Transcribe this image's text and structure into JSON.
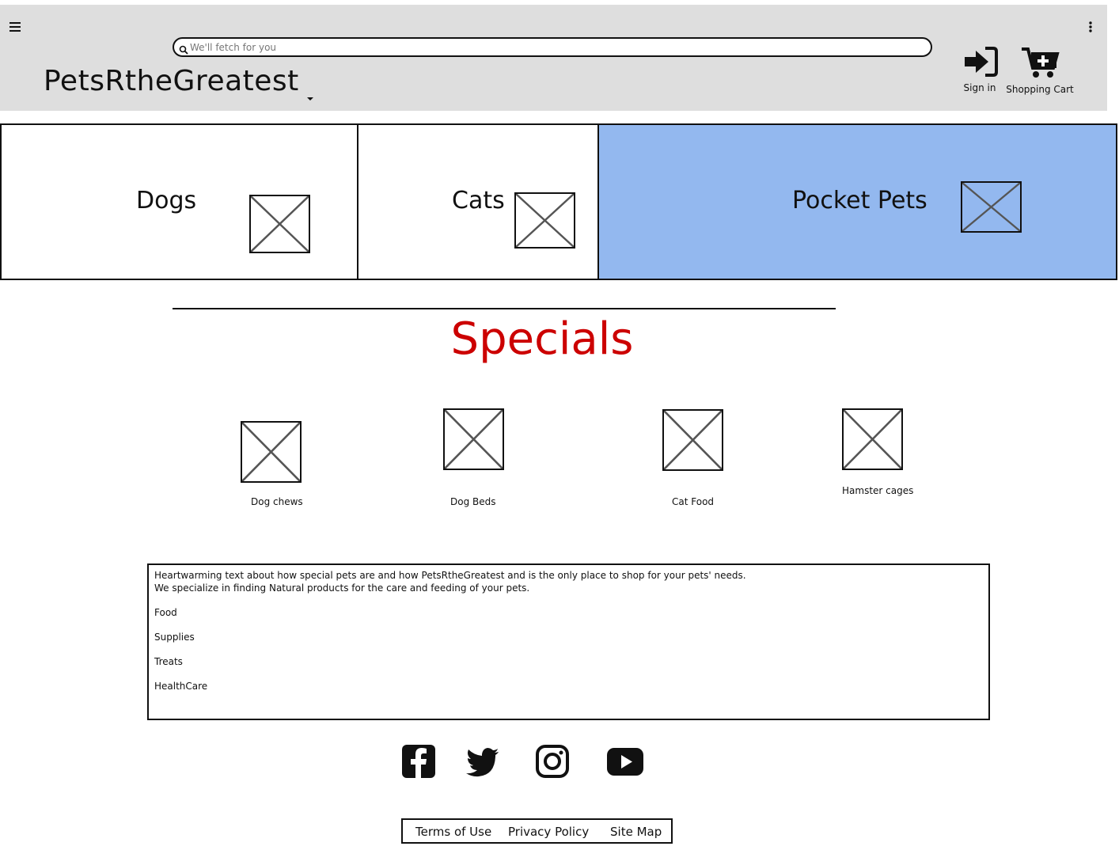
{
  "header": {
    "brand": "PetsRtheGreatest",
    "search_placeholder": "We'll fetch for you",
    "signin_label": "Sign in",
    "cart_label": "Shopping Cart"
  },
  "categories": [
    {
      "label": "Dogs"
    },
    {
      "label": "Cats"
    },
    {
      "label": "Pocket Pets",
      "selected": true
    }
  ],
  "specials": {
    "title": "Specials",
    "items": [
      {
        "label": "Dog chews"
      },
      {
        "label": "Dog Beds"
      },
      {
        "label": "Cat Food"
      },
      {
        "label": "Hamster cages"
      }
    ]
  },
  "info": {
    "line1": "Heartwarming text about how special pets are and how PetsRtheGreatest and is the only place to shop for your pets' needs.",
    "line2": "We specialize in finding Natural products for the care and feeding of your pets.",
    "list": [
      "Food",
      "Supplies",
      "Treats",
      "HealthCare"
    ]
  },
  "social": [
    "facebook-icon",
    "twitter-icon",
    "instagram-icon",
    "youtube-icon"
  ],
  "footer": {
    "terms": "Terms of Use",
    "privacy": "Privacy Policy",
    "sitemap": "Site Map"
  },
  "colors": {
    "header_bg": "#dedede",
    "selected_tab": "#93b8ef",
    "specials_title": "#cc0000"
  }
}
